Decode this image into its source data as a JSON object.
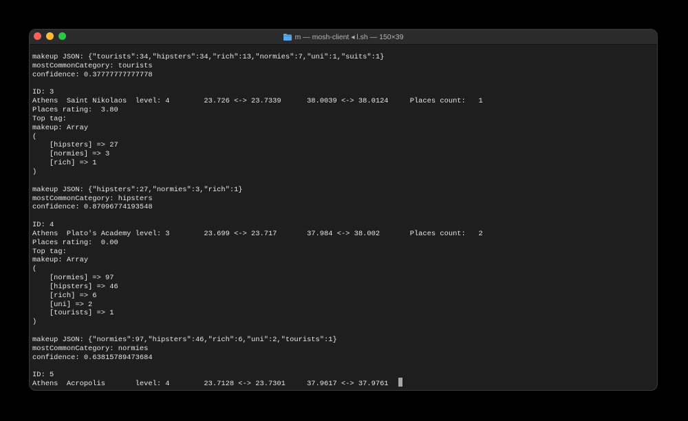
{
  "window": {
    "title": "m — mosh-client ◂ l.sh — 150×39",
    "colors": {
      "close": "#ff5f57",
      "minimize": "#febc2e",
      "zoom": "#28c840",
      "folder": "#5aa9e6",
      "background": "#1e1e1e",
      "text": "#e6e6e6"
    }
  },
  "terminal": {
    "lines": [
      "makeup JSON: {\"tourists\":34,\"hipsters\":34,\"rich\":13,\"normies\":7,\"uni\":1,\"suits\":1}",
      "mostCommonCategory: tourists",
      "confidence: 0.37777777777778",
      "",
      "ID: 3",
      "Athens  Saint Nikolaos  level: 4        23.726 <-> 23.7339      38.0039 <-> 38.0124     Places count:   1",
      "Places rating:  3.80",
      "Top tag:",
      "makeup: Array",
      "(",
      "    [hipsters] => 27",
      "    [normies] => 3",
      "    [rich] => 1",
      ")",
      "",
      "makeup JSON: {\"hipsters\":27,\"normies\":3,\"rich\":1}",
      "mostCommonCategory: hipsters",
      "confidence: 0.87096774193548",
      "",
      "ID: 4",
      "Athens  Plato's Academy level: 3        23.699 <-> 23.717       37.984 <-> 38.002       Places count:   2",
      "Places rating:  0.00",
      "Top tag:",
      "makeup: Array",
      "(",
      "    [normies] => 97",
      "    [hipsters] => 46",
      "    [rich] => 6",
      "    [uni] => 2",
      "    [tourists] => 1",
      ")",
      "",
      "makeup JSON: {\"normies\":97,\"hipsters\":46,\"rich\":6,\"uni\":2,\"tourists\":1}",
      "mostCommonCategory: normies",
      "confidence: 0.63815789473684",
      "",
      "ID: 5",
      "Athens  Acropolis       level: 4        23.7128 <-> 23.7301     37.9617 <-> 37.9761"
    ]
  }
}
